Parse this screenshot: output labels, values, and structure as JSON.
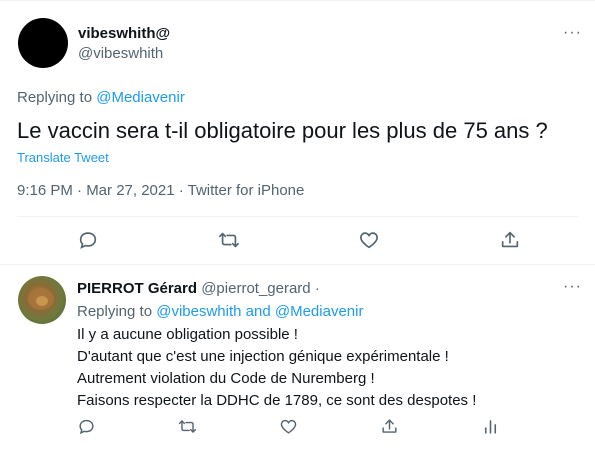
{
  "main_tweet": {
    "display_name": "vibeswhith@",
    "handle": "@vibeswhith",
    "replying_prefix": "Replying to",
    "replying_to": "@Mediavenir",
    "text": "Le vaccin sera t-il obligatoire pour les plus de 75 ans ?",
    "translate_label": "Translate Tweet",
    "timestamp": "9:16 PM · Mar 27, 2021 · Twitter for iPhone",
    "more_label": "···"
  },
  "reply_tweet": {
    "display_name": "PIERROT Gérard",
    "handle": "@pierrot_gerard ·",
    "replying_prefix": "Replying to",
    "replying_to_1": "@vibeswhith",
    "replying_and": "and",
    "replying_to_2": "@Mediavenir",
    "lines": [
      "Il y a aucune obligation possible !",
      "D'autant que c'est une injection génique expérimentale !",
      "Autrement violation du Code de Nuremberg !",
      "Faisons respecter la DDHC de 1789, ce sont des despotes !"
    ],
    "more_label": "···"
  },
  "colors": {
    "link": "#1d9bf0",
    "secondary_text": "#536471",
    "divider": "#eff3f4"
  },
  "icons": [
    "reply-icon",
    "retweet-icon",
    "like-icon",
    "share-icon",
    "analytics-icon",
    "more-icon"
  ]
}
